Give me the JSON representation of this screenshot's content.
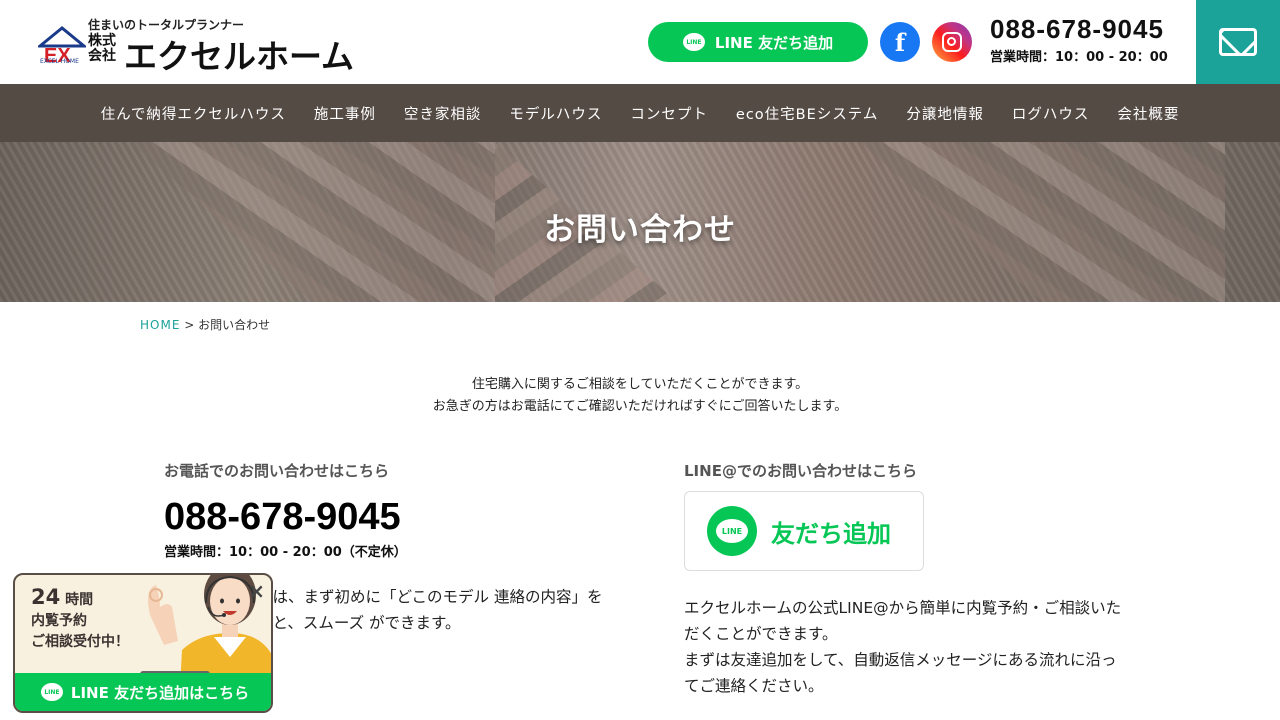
{
  "header": {
    "logo_tagline": "住まいのトータルプランナー",
    "logo_kaisha": "株式会社",
    "logo_name": "エクセルホーム",
    "logo_mark": "EX",
    "logo_en": "EXCEL HOME",
    "line_button": "LINE 友だち追加",
    "line_badge": "LINE",
    "facebook_icon": "f",
    "tel": "088-678-9045",
    "hours": "営業時間：10：00 - 20：00",
    "mail_icon": "envelope-icon"
  },
  "nav": {
    "items": [
      "住んで納得エクセルハウス",
      "施工事例",
      "空き家相談",
      "モデルハウス",
      "コンセプト",
      "eco住宅BEシステム",
      "分譲地情報",
      "ログハウス",
      "会社概要"
    ]
  },
  "hero": {
    "title": "お問い合わせ"
  },
  "breadcrumb": {
    "home": "HOME",
    "separator": ">",
    "current": "お問い合わせ"
  },
  "intro": {
    "line1": "住宅購入に関するご相談をしていただくことができます。",
    "line2": "お急ぎの方はお電話にてご確認いただければすぐにご回答いたします。"
  },
  "phone_section": {
    "heading": "お電話でのお問い合わせはこちら",
    "number": "088-678-9045",
    "hours": "営業時間：10：00 - 20：00（不定休）",
    "text": "連絡いただく際は、まず初めに「どこのモデル 連絡の内容」をご説明いただくと、スムーズ ができます。"
  },
  "line_section": {
    "heading": "LINE@でのお問い合わせはこちら",
    "card_label": "友だち追加",
    "card_badge": "LINE",
    "text_line1": "エクセルホームの公式LINE@から簡単に内覧予約・ご相談いただくことができます。",
    "text_line2": "まずは友達追加をして、自動返信メッセージにある流れに沿ってご連絡ください。"
  },
  "widget": {
    "hours_number": "24",
    "hours_unit": "時間",
    "line2": "内覧予約",
    "line3": "ご相談受付中！",
    "close": "×",
    "bar_label": "LINE 友だち追加はこちら",
    "bar_badge": "LINE"
  },
  "colors": {
    "line_green": "#06c755",
    "teal": "#1ba39a",
    "nav_bg": "#544b45"
  }
}
